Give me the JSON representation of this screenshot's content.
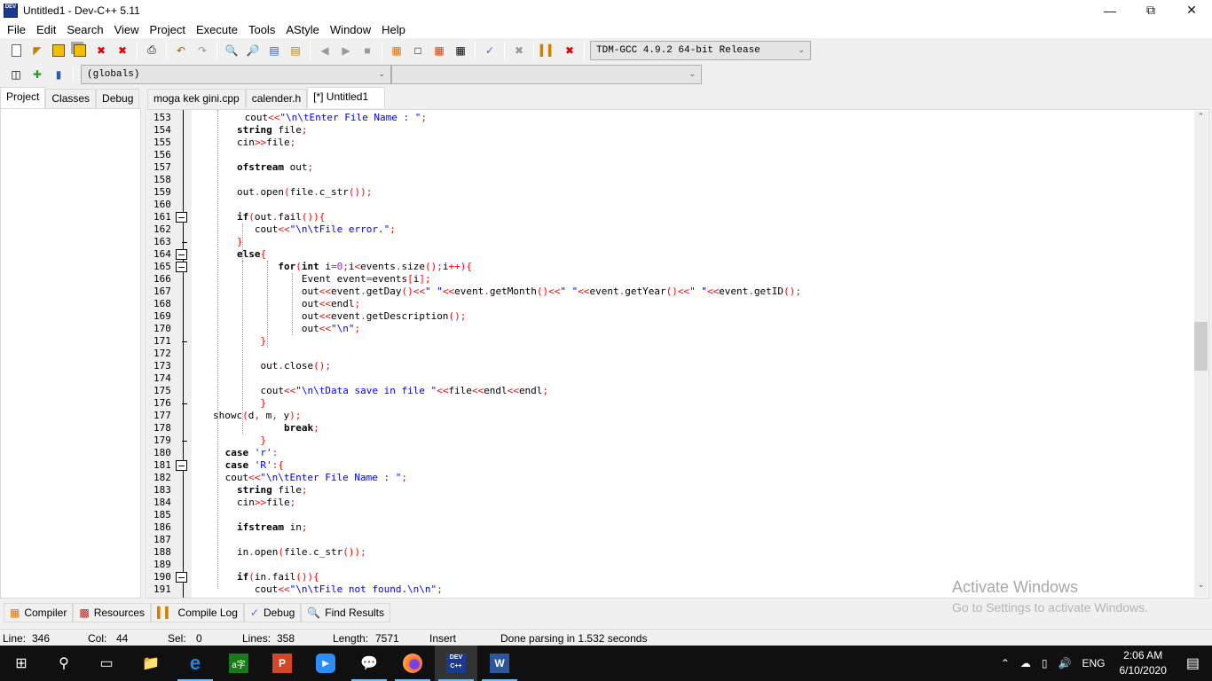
{
  "window": {
    "title": "Untitled1 - Dev-C++ 5.11",
    "app_icon_label": "DEV"
  },
  "menu": [
    "File",
    "Edit",
    "Search",
    "View",
    "Project",
    "Execute",
    "Tools",
    "AStyle",
    "Window",
    "Help"
  ],
  "toolbar": {
    "compiler_select": "TDM-GCC 4.9.2 64-bit Release",
    "scope_select": "(globals)",
    "member_select": ""
  },
  "left_tabs": [
    "Project",
    "Classes",
    "Debug"
  ],
  "editor_tabs": [
    "moga kek gini.cpp",
    "calender.h",
    "[*] Untitled1"
  ],
  "code_lines": [
    {
      "n": "153",
      "t": " cout<<\"\\n\\tEnter File Name : \";"
    },
    {
      "n": "154",
      "t": "string file;"
    },
    {
      "n": "155",
      "t": "cin>>file;"
    },
    {
      "n": "156",
      "t": ""
    },
    {
      "n": "157",
      "t": "ofstream out;"
    },
    {
      "n": "158",
      "t": ""
    },
    {
      "n": "159",
      "t": "out.open(file.c_str());"
    },
    {
      "n": "160",
      "t": ""
    },
    {
      "n": "161",
      "t": "if(out.fail()){"
    },
    {
      "n": "162",
      "t": "   cout<<\"\\n\\tFile error.\";"
    },
    {
      "n": "163",
      "t": "}"
    },
    {
      "n": "164",
      "t": "else{"
    },
    {
      "n": "165",
      "t": "       for(int i=0;i<events.size();i++){"
    },
    {
      "n": "166",
      "t": "           Event event=events[i];"
    },
    {
      "n": "167",
      "t": "           out<<event.getDay()<<\" \"<<event.getMonth()<<\" \"<<event.getYear()<<\" \"<<event.getID();"
    },
    {
      "n": "168",
      "t": "           out<<endl;"
    },
    {
      "n": "169",
      "t": "           out<<event.getDescription();"
    },
    {
      "n": "170",
      "t": "           out<<\"\\n\";"
    },
    {
      "n": "171",
      "t": "    }"
    },
    {
      "n": "172",
      "t": ""
    },
    {
      "n": "173",
      "t": "    out.close();"
    },
    {
      "n": "174",
      "t": ""
    },
    {
      "n": "175",
      "t": "    cout<<\"\\n\\tData save in file \"<<file<<endl<<endl;"
    },
    {
      "n": "176",
      "t": "    }"
    },
    {
      "n": "177",
      "t": "showc(d, m, y);"
    },
    {
      "n": "178",
      "t": "        break;"
    },
    {
      "n": "179",
      "t": "    }"
    },
    {
      "n": "180",
      "t": " case 'r':"
    },
    {
      "n": "181",
      "t": " case 'R':{"
    },
    {
      "n": "182",
      "t": " cout<<\"\\n\\tEnter File Name : \";"
    },
    {
      "n": "183",
      "t": "string file;"
    },
    {
      "n": "184",
      "t": "cin>>file;"
    },
    {
      "n": "185",
      "t": ""
    },
    {
      "n": "186",
      "t": "ifstream in;"
    },
    {
      "n": "187",
      "t": ""
    },
    {
      "n": "188",
      "t": "in.open(file.c_str());"
    },
    {
      "n": "189",
      "t": ""
    },
    {
      "n": "190",
      "t": "if(in.fail()){"
    },
    {
      "n": "191",
      "t": "   cout<<\"\\n\\tFile not found.\\n\\n\";"
    }
  ],
  "bottom_tabs": [
    {
      "label": "Compiler",
      "icon": "compiler-icon"
    },
    {
      "label": "Resources",
      "icon": "resources-icon"
    },
    {
      "label": "Compile Log",
      "icon": "compile-log-icon"
    },
    {
      "label": "Debug",
      "icon": "debug-check-icon"
    },
    {
      "label": "Find Results",
      "icon": "find-results-icon"
    }
  ],
  "status": {
    "line_label": "Line:",
    "line": "346",
    "col_label": "Col:",
    "col": "44",
    "sel_label": "Sel:",
    "sel": "0",
    "lines_label": "Lines:",
    "lines": "358",
    "length_label": "Length:",
    "length": "7571",
    "mode": "Insert",
    "message": "Done parsing in 1.532 seconds"
  },
  "watermark": {
    "title": "Activate Windows",
    "subtitle": "Go to Settings to activate Windows."
  },
  "taskbar": {
    "lang": "ENG",
    "time": "2:06 AM",
    "date": "6/10/2020"
  },
  "colors": {
    "keyword": "#000000",
    "string": "#0000ff",
    "operator": "#ff0000",
    "number": "#a020f0"
  }
}
